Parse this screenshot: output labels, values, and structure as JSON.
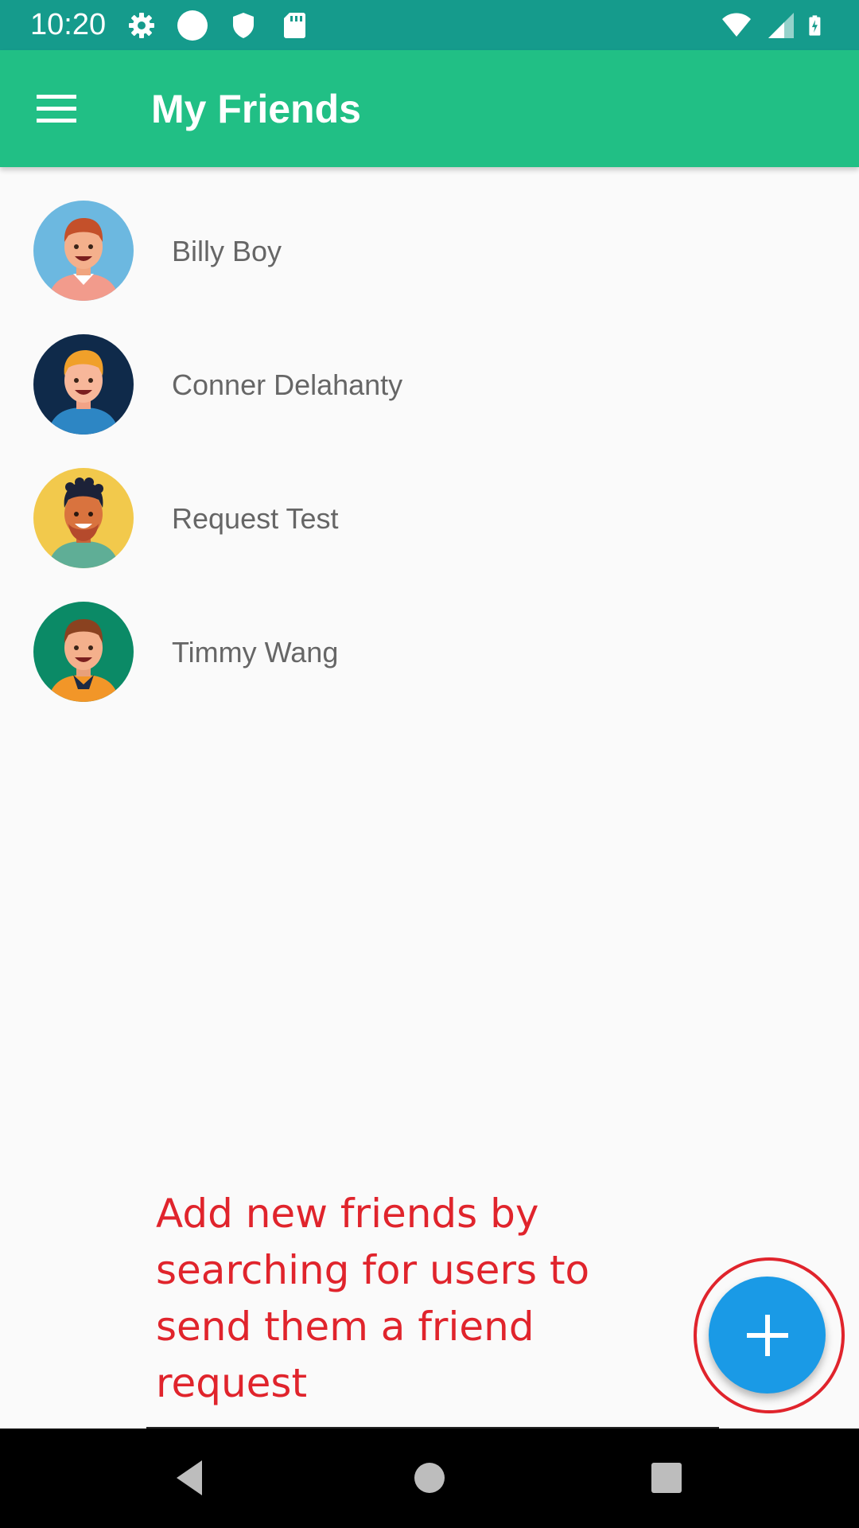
{
  "status_bar": {
    "time": "10:20",
    "left_icons": [
      "gear-icon",
      "circle-icon",
      "shield-icon",
      "sd-card-icon"
    ],
    "right_icons": [
      "wifi-icon",
      "cell-signal-icon",
      "battery-charging-icon"
    ]
  },
  "app_bar": {
    "menu_icon": "hamburger-menu-icon",
    "title": "My Friends",
    "background_color": "#21bf85"
  },
  "friends": [
    {
      "name": "Billy Boy",
      "avatar_bg": "#6cb8e0"
    },
    {
      "name": "Conner Delahanty",
      "avatar_bg": "#0f2a4a"
    },
    {
      "name": "Request Test",
      "avatar_bg": "#f2c94c"
    },
    {
      "name": "Timmy Wang",
      "avatar_bg": "#0b8a66"
    }
  ],
  "hint": {
    "text": "Add new friends by searching for users to send them a friend request",
    "color": "#e0242c"
  },
  "fab": {
    "icon": "plus-icon",
    "color": "#1a9ae6"
  },
  "nav_bar": {
    "buttons": [
      "back-icon",
      "home-icon",
      "recents-icon"
    ]
  }
}
